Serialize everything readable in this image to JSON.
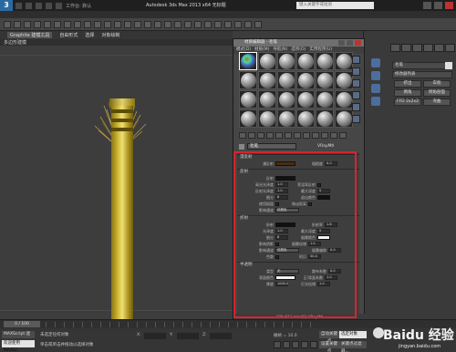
{
  "titlebar": {
    "workspace_label": "工作台: 默认",
    "title": "Autodesk 3ds Max 2013 x64   无标题",
    "search_placeholder": "键入关键字或短语"
  },
  "ribbon": {
    "tabs": [
      "Graphite 建模工具",
      "自由形式",
      "选择",
      "对象绘制"
    ],
    "subtitle": "多边形建模"
  },
  "material_editor": {
    "title": "材质编辑器 - 毛笔",
    "menu": [
      "模式(D)",
      "材质(M)",
      "导航(N)",
      "选项(O)",
      "实用程序(U)"
    ],
    "material_name": "毛笔",
    "material_type": "VRayMtl",
    "status": "206x613 Intel(R) VRayMtl",
    "rollouts": {
      "basic": "漫反射",
      "reflection": "反射",
      "refraction": "折射",
      "translucency": "半透明"
    },
    "params": {
      "diffuse_label": "漫反射",
      "roughness_label": "粗糙度",
      "roughness_value": "0.0",
      "reflect_label": "反射",
      "hilight_gloss_label": "高光光泽度",
      "hilight_gloss_value": "1.0",
      "refl_gloss_label": "反射光泽度",
      "refl_gloss_value": "1.0",
      "subdivs_label": "细分",
      "subdivs_value": "8",
      "use_interp_label": "使用插值",
      "dim_distance_label": "暗淡距离",
      "affect_channels_label": "影响通道",
      "affect_channels_value": "仅颜色",
      "fresnel_label": "菲涅耳反射",
      "max_depth_label": "最大深度",
      "max_depth_value": "5",
      "exit_color_label": "退出颜色",
      "refract_label": "折射",
      "ior_label": "折射率",
      "ior_value": "1.6",
      "glossiness_label": "光泽度",
      "glossiness_value": "1.0",
      "refr_subdivs_label": "细分",
      "refr_subdivs_value": "8",
      "affect_shadows_label": "影响阴影",
      "fog_color_label": "烟雾颜色",
      "fog_multiplier_label": "烟雾倍增",
      "fog_multiplier_value": "1.0",
      "fog_bias_label": "烟雾偏移",
      "fog_bias_value": "0.0",
      "dispersion_label": "色散",
      "abbe_label": "阿贝",
      "abbe_value": "50.0",
      "type_label": "类型",
      "type_value": "无",
      "back_color_label": "背面颜色",
      "thickness_label": "厚度",
      "thickness_value": "1000.0",
      "scatter_coeff_label": "散布系数",
      "scatter_coeff_value": "0.0",
      "fwd_bck_label": "正/背面系数",
      "fwd_bck_value": "1.0",
      "light_mult_label": "灯光倍增",
      "light_mult_value": "1.0"
    }
  },
  "command_panel": {
    "object_name": "毛笔",
    "modifier_list": "修改器列表",
    "buttons": [
      "挤出",
      "车削",
      "倒角",
      "倒角剖面",
      "FFD 2x2x2",
      "弯曲"
    ]
  },
  "timeline": {
    "frame": "0 / 100"
  },
  "statusbar": {
    "script_label": "MAXScript 迷",
    "selected_label": "欢迎使用 MAXSc",
    "prompt1": "未选定任何对象",
    "prompt2": "单击或单击并拖动以选择对象",
    "x_label": "X:",
    "y_label": "Y:",
    "z_label": "Z:",
    "grid": "栅格 = 10.0",
    "autokey": "自动关键点",
    "selected_obj": "选定对象",
    "setkey": "设置关键点",
    "key_filter": "关键点过滤器..."
  },
  "watermark": {
    "text": "Baidu 经验",
    "url": "jingyan.baidu.com"
  },
  "colors": {
    "highlight": "#d9232e",
    "handle": "#d9c23d"
  }
}
